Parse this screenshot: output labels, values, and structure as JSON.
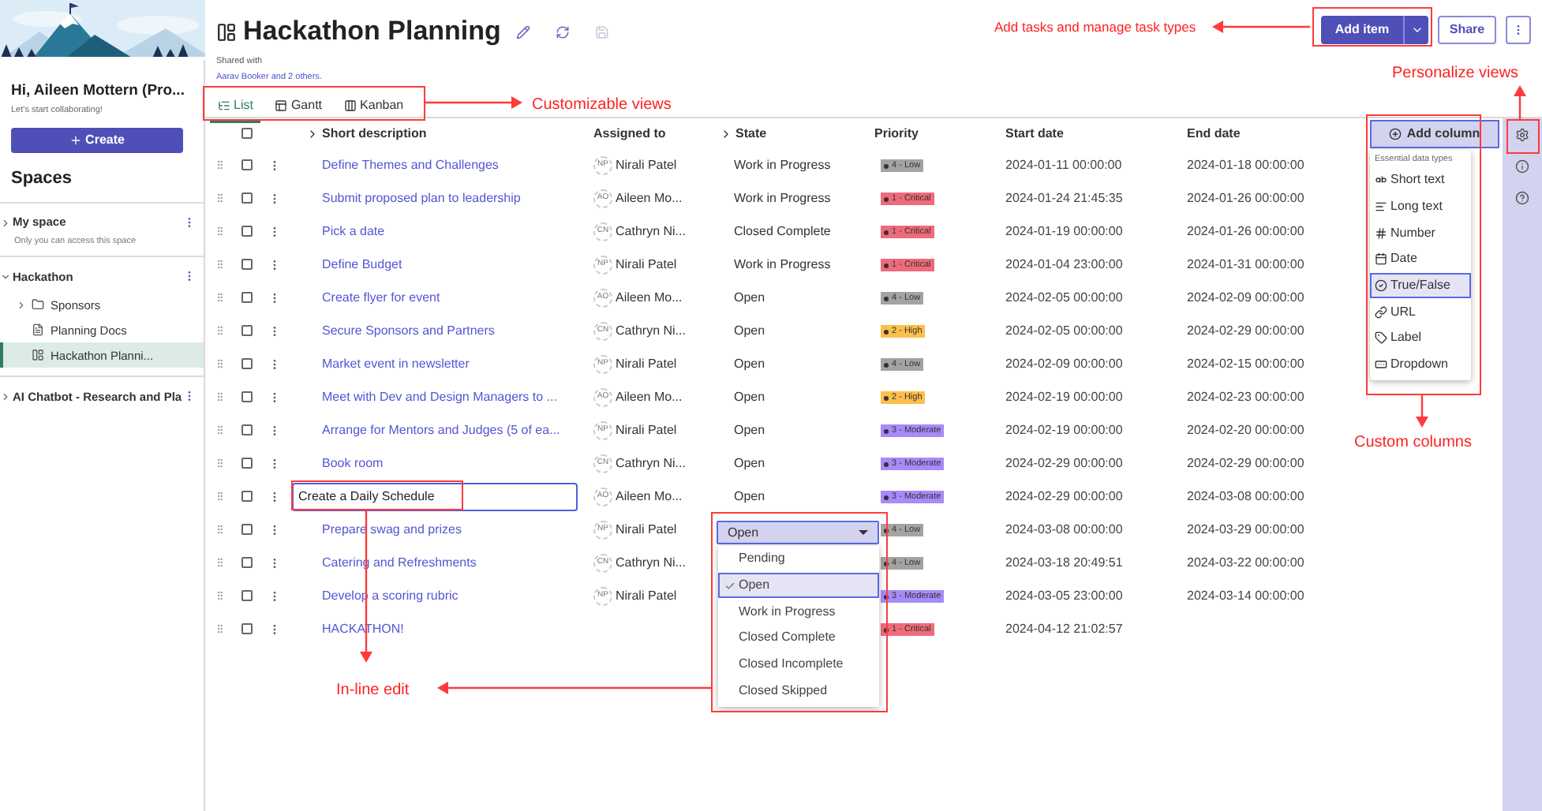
{
  "sidebar": {
    "greeting": "Hi, Aileen Mottern (Pro...",
    "subtitle": "Let's start collaborating!",
    "create_button": "Create",
    "spaces_title": "Spaces",
    "spaces": [
      {
        "name": "My space",
        "description": "Only you can access this space",
        "expanded": false
      },
      {
        "name": "Hackathon",
        "expanded": true,
        "children": [
          {
            "name": "Sponsors",
            "kind": "folder",
            "selected": false
          },
          {
            "name": "Planning Docs",
            "kind": "document",
            "selected": false
          },
          {
            "name": "Hackathon Planni...",
            "kind": "board",
            "selected": true
          }
        ]
      },
      {
        "name": "AI Chatbot - Research and Pla",
        "expanded": false
      }
    ]
  },
  "header": {
    "title": "Hackathon Planning",
    "shared_label": "Shared with",
    "shared_with": "Aarav Booker and 2 others.",
    "add_item_button": "Add item",
    "share_button": "Share"
  },
  "tabs": [
    {
      "label": "List",
      "kind": "list",
      "selected": true
    },
    {
      "label": "Gantt",
      "kind": "gantt",
      "selected": false
    },
    {
      "label": "Kanban",
      "kind": "kanban",
      "selected": false
    }
  ],
  "table": {
    "columns": [
      "Short description",
      "Assigned to",
      "State",
      "Priority",
      "Start date",
      "End date"
    ],
    "select_all_checked": false,
    "rows": [
      {
        "checked": false,
        "description": "Define Themes and Challenges",
        "initials": "NP",
        "assignee": "Nirali Patel",
        "state": "Work in Progress",
        "priority": {
          "label": "4 - Low",
          "color": "#a3a3a3"
        },
        "start": "2024-01-11 00:00:00",
        "end": "2024-01-18 00:00:00"
      },
      {
        "checked": false,
        "description": "Submit proposed plan to leadership",
        "initials": "AO",
        "assignee": "Aileen Mo...",
        "state": "Work in Progress",
        "priority": {
          "label": "1 - Critical",
          "color": "#ef6b7b"
        },
        "start": "2024-01-24 21:45:35",
        "end": "2024-01-26 00:00:00"
      },
      {
        "checked": false,
        "description": "Pick a date",
        "initials": "CN",
        "assignee": "Cathryn Ni...",
        "state": "Closed Complete",
        "priority": {
          "label": "1 - Critical",
          "color": "#ef6b7b"
        },
        "start": "2024-01-19 00:00:00",
        "end": "2024-01-26 00:00:00"
      },
      {
        "checked": false,
        "description": "Define Budget",
        "initials": "NP",
        "assignee": "Nirali Patel",
        "state": "Work in Progress",
        "priority": {
          "label": "1 - Critical",
          "color": "#ef6b7b"
        },
        "start": "2024-01-04 23:00:00",
        "end": "2024-01-31 00:00:00"
      },
      {
        "checked": false,
        "description": "Create flyer for event",
        "initials": "AO",
        "assignee": "Aileen Mo...",
        "state": "Open",
        "priority": {
          "label": "4 - Low",
          "color": "#a3a3a3"
        },
        "start": "2024-02-05 00:00:00",
        "end": "2024-02-09 00:00:00"
      },
      {
        "checked": false,
        "description": "Secure Sponsors and Partners",
        "initials": "CN",
        "assignee": "Cathryn Ni...",
        "state": "Open",
        "priority": {
          "label": "2 - High",
          "color": "#fbbf4b"
        },
        "start": "2024-02-05 00:00:00",
        "end": "2024-02-29 00:00:00"
      },
      {
        "checked": false,
        "description": "Market event in newsletter",
        "initials": "NP",
        "assignee": "Nirali Patel",
        "state": "Open",
        "priority": {
          "label": "4 - Low",
          "color": "#a3a3a3"
        },
        "start": "2024-02-09 00:00:00",
        "end": "2024-02-15 00:00:00"
      },
      {
        "checked": false,
        "description": "Meet with Dev and Design Managers to ...",
        "initials": "AO",
        "assignee": "Aileen Mo...",
        "state": "Open",
        "priority": {
          "label": "2 - High",
          "color": "#fbbf4b"
        },
        "start": "2024-02-19 00:00:00",
        "end": "2024-02-23 00:00:00"
      },
      {
        "checked": false,
        "description": "Arrange for Mentors and Judges (5 of ea...",
        "initials": "NP",
        "assignee": "Nirali Patel",
        "state": "Open",
        "priority": {
          "label": "3 - Moderate",
          "color": "#a78bfa"
        },
        "start": "2024-02-19 00:00:00",
        "end": "2024-02-20 00:00:00"
      },
      {
        "checked": false,
        "description": "Book room",
        "initials": "CN",
        "assignee": "Cathryn Ni...",
        "state": "Open",
        "priority": {
          "label": "3 - Moderate",
          "color": "#a78bfa"
        },
        "start": "2024-02-29 00:00:00",
        "end": "2024-02-29 00:00:00"
      },
      {
        "checked": false,
        "description": "Create a Daily Schedule",
        "editing": true,
        "initials": "AO",
        "assignee": "Aileen Mo...",
        "state": "Open",
        "priority": {
          "label": "3 - Moderate",
          "color": "#a78bfa"
        },
        "start": "2024-02-29 00:00:00",
        "end": "2024-03-08 00:00:00"
      },
      {
        "checked": false,
        "description": "Prepare swag and prizes",
        "initials": "NP",
        "assignee": "Nirali Patel",
        "state_editor": {
          "value": "Open",
          "options": [
            {
              "label": "Pending",
              "selected": false
            },
            {
              "label": "Open",
              "selected": true
            },
            {
              "label": "Work in Progress",
              "selected": false
            },
            {
              "label": "Closed Complete",
              "selected": false
            },
            {
              "label": "Closed Incomplete",
              "selected": false
            },
            {
              "label": "Closed Skipped",
              "selected": false
            }
          ]
        },
        "priority": {
          "label": "4 - Low",
          "color": "#a3a3a3"
        },
        "start": "2024-03-08 00:00:00",
        "end": "2024-03-29 00:00:00"
      },
      {
        "checked": false,
        "description": "Catering and Refreshments",
        "initials": "CN",
        "assignee": "Cathryn Ni...",
        "priority": {
          "label": "4 - Low",
          "color": "#a3a3a3"
        },
        "start": "2024-03-18 20:49:51",
        "end": "2024-03-22 00:00:00"
      },
      {
        "checked": false,
        "description": "Develop a scoring rubric",
        "initials": "NP",
        "assignee": "Nirali Patel",
        "priority": {
          "label": "3 - Moderate",
          "color": "#a78bfa"
        },
        "start": "2024-03-05 23:00:00",
        "end": "2024-03-14 00:00:00"
      },
      {
        "checked": false,
        "description": "HACKATHON!",
        "priority": {
          "label": "1 - Critical",
          "color": "#ef6b7b"
        },
        "start": "2024-04-12 21:02:57"
      }
    ]
  },
  "add_column": {
    "button": "Add column",
    "menu_title": "Essential data types",
    "items": [
      {
        "label": "Short text",
        "kind": "short_text",
        "selected": false
      },
      {
        "label": "Long text",
        "kind": "long_text",
        "selected": false
      },
      {
        "label": "Number",
        "kind": "number",
        "selected": false
      },
      {
        "label": "Date",
        "kind": "date",
        "selected": false
      },
      {
        "label": "True/False",
        "kind": "boolean",
        "selected": true
      },
      {
        "label": "URL",
        "kind": "url",
        "selected": false
      },
      {
        "label": "Label",
        "kind": "label",
        "selected": false
      },
      {
        "label": "Dropdown",
        "kind": "dropdown",
        "selected": false
      }
    ]
  },
  "annotations": [
    {
      "text": "Add tasks and manage task types",
      "kind": "add_tasks"
    },
    {
      "text": "Customizable views",
      "kind": "views"
    },
    {
      "text": "Personalize views",
      "kind": "personalize"
    },
    {
      "text": "Custom columns",
      "kind": "custom_columns"
    },
    {
      "text": "In-line edit",
      "kind": "inline_edit"
    }
  ]
}
